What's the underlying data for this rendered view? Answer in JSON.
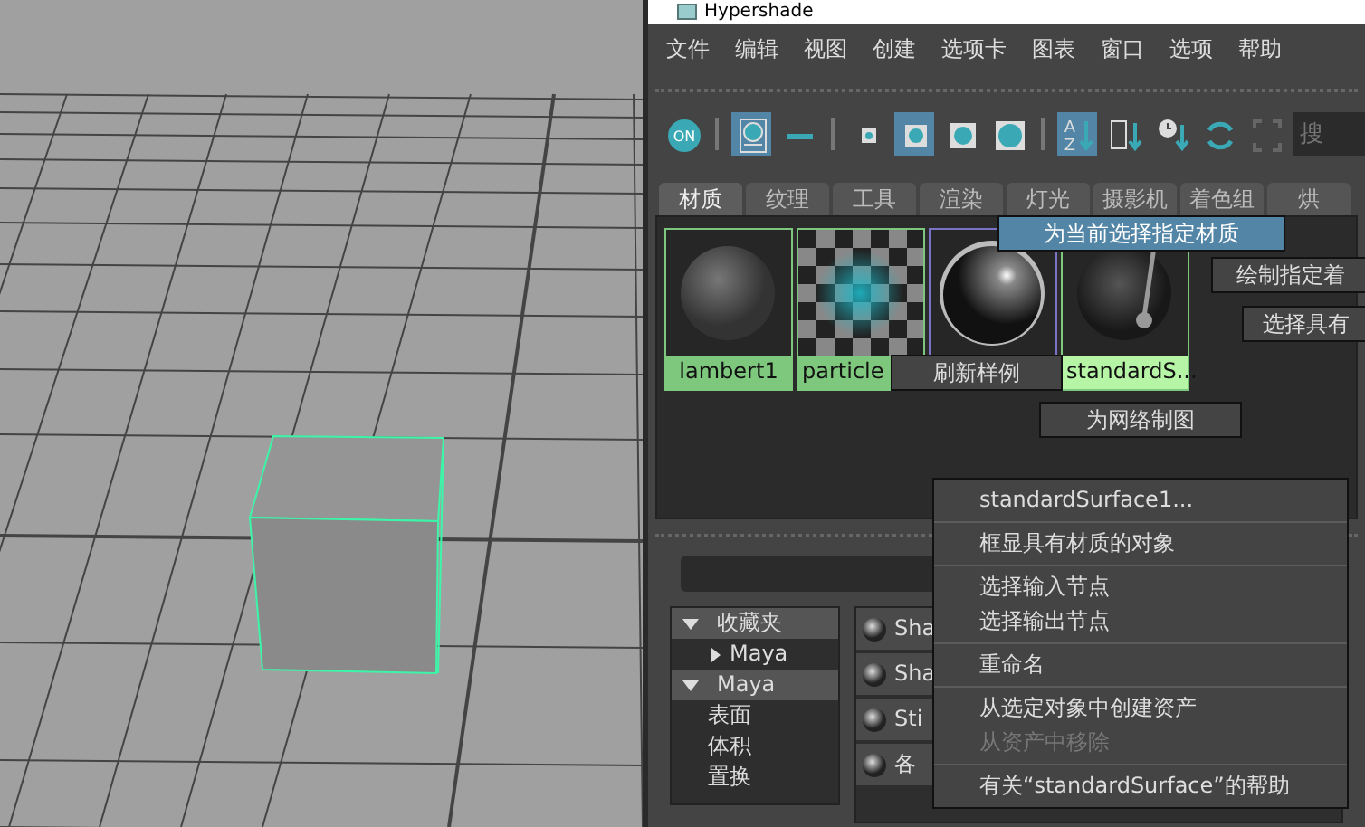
{
  "viewport": {
    "object_selected": true
  },
  "window": {
    "title": "Hypershade"
  },
  "menu": [
    "文件",
    "编辑",
    "视图",
    "创建",
    "选项卡",
    "图表",
    "窗口",
    "选项",
    "帮助"
  ],
  "toolbar": [
    {
      "kind": "on",
      "on": false,
      "text": [
        "ON"
      ]
    },
    {
      "kind": "display",
      "on": true
    },
    {
      "kind": "dash",
      "on": false
    },
    {
      "kind": "size-tiny",
      "on": false
    },
    {
      "kind": "size-small",
      "on": true
    },
    {
      "kind": "size-medium",
      "on": false
    },
    {
      "kind": "size-large",
      "on": false
    },
    {
      "kind": "sort-name",
      "on": true,
      "text": [
        "A",
        "Z"
      ]
    },
    {
      "kind": "sort-type",
      "on": false
    },
    {
      "kind": "sort-time",
      "on": false
    },
    {
      "kind": "refresh",
      "on": false
    },
    {
      "kind": "frame",
      "on": false
    }
  ],
  "search": {
    "placeholder": "搜"
  },
  "tabs": [
    {
      "label": "材质",
      "selected": true
    },
    {
      "label": "纹理",
      "selected": false
    },
    {
      "label": "工具",
      "selected": false
    },
    {
      "label": "渲染",
      "selected": false
    },
    {
      "label": "灯光",
      "selected": false
    },
    {
      "label": "摄影机",
      "selected": false
    },
    {
      "label": "着色组",
      "selected": false
    },
    {
      "label": "烘",
      "selected": false
    }
  ],
  "swatches": [
    {
      "kind": "matte",
      "label": "lambert1",
      "selected": true,
      "active": false
    },
    {
      "kind": "checker",
      "label": "particle",
      "selected": true,
      "active": false
    },
    {
      "kind": "glossy",
      "selected": false
    },
    {
      "kind": "dark",
      "label": "standardS...",
      "selected": true,
      "active": true
    }
  ],
  "marking_menu": [
    {
      "label": "为当前选择指定材质",
      "highlighted": true
    },
    {
      "label": "绘制指定着",
      "highlighted": false
    },
    {
      "label": "选择具有",
      "highlighted": false
    },
    {
      "label": "刷新样例",
      "highlighted": false
    },
    {
      "label": "为网络制图",
      "highlighted": false
    }
  ],
  "tree": [
    {
      "label": "收藏夹",
      "expanded": true,
      "children": [
        {
          "label": "Maya",
          "expanded": false
        }
      ]
    },
    {
      "label": "Maya",
      "expanded": true,
      "children": [
        {
          "label": "表面"
        },
        {
          "label": "体积"
        },
        {
          "label": "置换"
        }
      ]
    }
  ],
  "materials": [
    "Sha",
    "Sha",
    "Sti",
    "各"
  ],
  "context_menu": [
    [
      {
        "label": "standardSurface1...",
        "disabled": false
      }
    ],
    [
      {
        "label": "框显具有材质的对象",
        "disabled": false
      }
    ],
    [
      {
        "label": "选择输入节点",
        "disabled": false
      },
      {
        "label": "选择输出节点",
        "disabled": false
      }
    ],
    [
      {
        "label": "重命名",
        "disabled": false
      }
    ],
    [
      {
        "label": "从选定对象中创建资产",
        "disabled": false
      },
      {
        "label": "从资产中移除",
        "disabled": true
      }
    ],
    [
      {
        "label": "有关“standardSurface”的帮助",
        "disabled": false
      }
    ]
  ]
}
